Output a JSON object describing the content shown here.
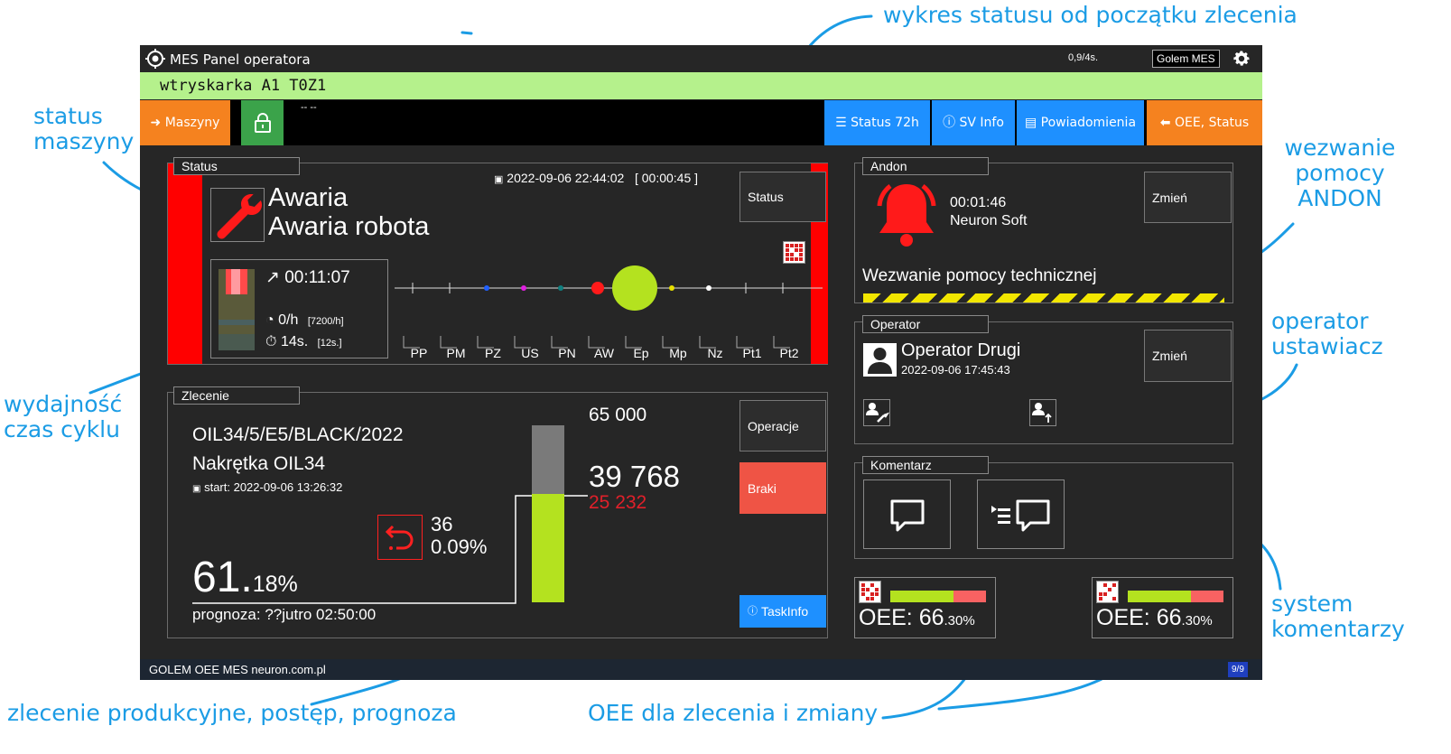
{
  "annotations": {
    "status_chart": "wykres statusu od początku zlecenia",
    "machine_status_1": "status",
    "machine_status_2": "maszyny",
    "andon_1": "wezwanie",
    "andon_2": "pomocy",
    "andon_3": "ANDON",
    "operator_1": "operator",
    "operator_2": "ustawiacz",
    "performance_1": "wydajność",
    "performance_2": "czas cyklu",
    "comments_1": "system",
    "comments_2": "komentarzy",
    "order": "zlecenie produkcyjne, postęp, prognoza",
    "oee": "OEE dla zlecenia i zmiany"
  },
  "titlebar": {
    "title": "MES Panel operatora",
    "rate": "0,9/4s.",
    "brand": "Golem MES"
  },
  "machine": {
    "name": "wtryskarka A1 T0Z1"
  },
  "toolbar": {
    "machines": "Maszyny",
    "status_text": "-- --",
    "status72": "Status 72h",
    "sv_info": "SV Info",
    "notifications": "Powiadomienia",
    "oee_status": "OEE, Status"
  },
  "status": {
    "legend": "Status",
    "datetime": "2022-09-06 22:44:02",
    "elapsed": "[ 00:00:45 ]",
    "button": "Status",
    "title1": "Awaria",
    "title2": "Awaria robota",
    "duration": "00:11:07",
    "rate": "0/h",
    "rate_nominal": "[7200/h]",
    "cycle": "14s.",
    "cycle_nominal": "[12s.]",
    "codes": [
      "PP",
      "PM",
      "PZ",
      "US",
      "PN",
      "AW",
      "Ep",
      "Mp",
      "Nz",
      "Pt1",
      "Pt2"
    ]
  },
  "order": {
    "legend": "Zlecenie",
    "code": "OIL34/5/E5/BLACK/2022",
    "product": "Nakrętka OIL34",
    "start": "start: 2022-09-06 13:26:32",
    "scrap_count": "36",
    "scrap_pct": "0.09%",
    "progress_int": "61",
    "progress_dot": ".",
    "progress_frac": "18%",
    "forecast": "prognoza: ??jutro 02:50:00",
    "target": "65 000",
    "done": "39 768",
    "remaining": "25 232",
    "progress_fraction": 0.6118,
    "btn_operations": "Operacje",
    "btn_scrap": "Braki",
    "btn_taskinfo": "TaskInfo"
  },
  "andon": {
    "legend": "Andon",
    "time": "00:01:46",
    "source": "Neuron Soft",
    "button": "Zmień",
    "message": "Wezwanie pomocy technicznej"
  },
  "operator": {
    "legend": "Operator",
    "name": "Operator Drugi",
    "since": "2022-09-06 17:45:43",
    "button": "Zmień"
  },
  "comment": {
    "legend": "Komentarz"
  },
  "oee": [
    {
      "label": "OEE: ",
      "int": "66",
      "frac": ".30%",
      "fraction": 0.663
    },
    {
      "label": "OEE: ",
      "int": "66",
      "frac": ".30%",
      "fraction": 0.663
    }
  ],
  "footer": {
    "text": "GOLEM OEE MES neuron.com.pl",
    "page": "9/9"
  },
  "colors": {
    "alarm": "#ff0000",
    "green": "#b4e21f",
    "orange": "#f5821f",
    "blue": "#1e90ff",
    "accent_blue": "#1b9ce5"
  }
}
